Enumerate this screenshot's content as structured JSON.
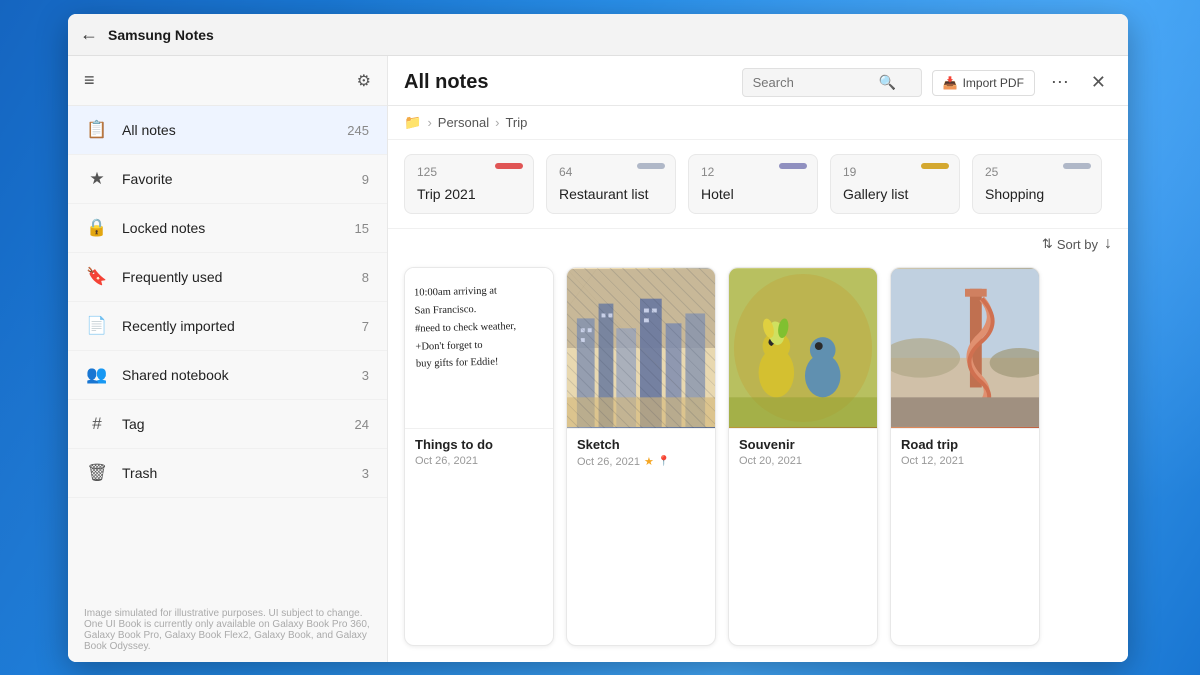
{
  "app": {
    "title": "Samsung Notes",
    "back_label": "←",
    "close_label": "✕"
  },
  "sidebar": {
    "hamburger_label": "≡",
    "settings_label": "⚙",
    "items": [
      {
        "id": "all-notes",
        "icon": "📋",
        "label": "All notes",
        "count": "245",
        "active": true
      },
      {
        "id": "favorite",
        "icon": "★",
        "label": "Favorite",
        "count": "9"
      },
      {
        "id": "locked-notes",
        "icon": "🔒",
        "label": "Locked notes",
        "count": "15"
      },
      {
        "id": "frequently-used",
        "icon": "🔖",
        "label": "Frequently used",
        "count": "8"
      },
      {
        "id": "recently-imported",
        "icon": "📄",
        "label": "Recently imported",
        "count": "7"
      },
      {
        "id": "shared-notebook",
        "icon": "👥",
        "label": "Shared notebook",
        "count": "3"
      },
      {
        "id": "tag",
        "icon": "#",
        "label": "Tag",
        "count": "24"
      },
      {
        "id": "trash",
        "icon": "🗑",
        "label": "Trash",
        "count": "3"
      }
    ],
    "footer_text": "Image simulated for illustrative purposes. UI subject to change.\nOne UI Book is currently only available on Galaxy Book Pro 360,\nGalaxy Book Pro, Galaxy Book Flex2, Galaxy Book, and Galaxy Book Odyssey."
  },
  "notes_panel": {
    "title": "All notes",
    "search_placeholder": "Search",
    "import_pdf_label": "Import PDF",
    "more_label": "⋯",
    "close_label": "✕",
    "breadcrumb": [
      {
        "icon": "📁",
        "label": ""
      },
      {
        "label": "Personal"
      },
      {
        "label": "Trip"
      }
    ],
    "folders": [
      {
        "id": "trip-2021",
        "count": "125",
        "name": "Trip 2021",
        "tag_color": "#e05555"
      },
      {
        "id": "restaurant-list",
        "count": "64",
        "name": "Restaurant list",
        "tag_color": "#b0b8c8"
      },
      {
        "id": "hotel",
        "count": "12",
        "name": "Hotel",
        "tag_color": "#9090c0"
      },
      {
        "id": "gallery-list",
        "count": "19",
        "name": "Gallery list",
        "tag_color": "#d4a830"
      },
      {
        "id": "shopping",
        "count": "25",
        "name": "Shopping",
        "tag_color": "#b0b8c8"
      }
    ],
    "sort_label": "Sort by",
    "sort_icon": "↓",
    "notes": [
      {
        "id": "things-to-do",
        "type": "handwritten",
        "title": "Things to do",
        "date": "Oct 26, 2021",
        "starred": false,
        "gps": false,
        "lines": [
          "10:00am arriving at",
          "San Francisco.",
          "#need to check weather,",
          "+Don't forget to",
          "buy gifts for Eddie!"
        ]
      },
      {
        "id": "sketch",
        "type": "image",
        "image_style": "sketch",
        "title": "Sketch",
        "date": "Oct 26, 2021",
        "starred": true,
        "gps": true
      },
      {
        "id": "souvenir",
        "type": "image",
        "image_style": "souvenir",
        "title": "Souvenir",
        "date": "Oct 20, 2021",
        "starred": false,
        "gps": false
      },
      {
        "id": "road-trip",
        "type": "image",
        "image_style": "roadtrip",
        "title": "Road trip",
        "date": "Oct 12, 2021",
        "starred": false,
        "gps": false
      }
    ]
  },
  "icons": {
    "search": "🔍",
    "import": "📥",
    "settings": "⚙",
    "sort": "⇅",
    "star": "★",
    "gps": "📍",
    "folder": "📁"
  }
}
